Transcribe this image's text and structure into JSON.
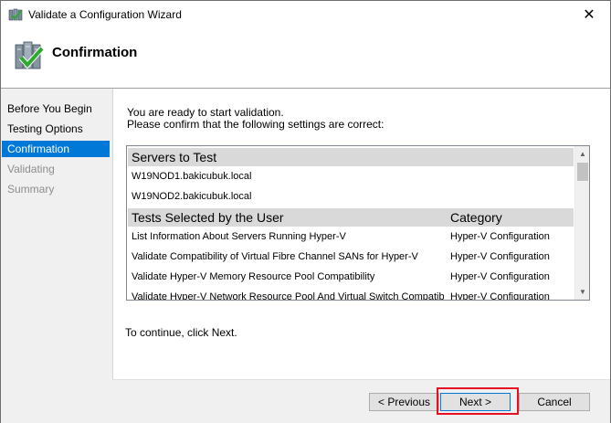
{
  "window": {
    "title": "Validate a Configuration Wizard",
    "close_glyph": "✕"
  },
  "header": {
    "title": "Confirmation",
    "icon": "validation-checklist-icon"
  },
  "sidebar": {
    "items": [
      {
        "label": "Before You Begin",
        "state": "normal"
      },
      {
        "label": "Testing Options",
        "state": "normal"
      },
      {
        "label": "Confirmation",
        "state": "active"
      },
      {
        "label": "Validating",
        "state": "disabled"
      },
      {
        "label": "Summary",
        "state": "disabled"
      }
    ]
  },
  "content": {
    "intro_line1": "You are ready to start validation.",
    "intro_line2": "Please confirm that the following settings are correct:",
    "servers_header": "Servers to Test",
    "servers": [
      "W19NOD1.bakicubuk.local",
      "W19NOD2.bakicubuk.local"
    ],
    "tests_header": "Tests Selected by the User",
    "category_header": "Category",
    "tests": [
      {
        "name": "List Information About Servers Running Hyper-V",
        "category": "Hyper-V Configuration"
      },
      {
        "name": "Validate Compatibility of Virtual Fibre Channel SANs for Hyper-V",
        "category": "Hyper-V Configuration"
      },
      {
        "name": "Validate Hyper-V Memory Resource Pool Compatibility",
        "category": "Hyper-V Configuration"
      },
      {
        "name": "Validate Hyper-V Network Resource Pool And Virtual Switch Compatibi",
        "category": "Hyper-V Configuration"
      }
    ],
    "continue_text": "To continue, click Next."
  },
  "buttons": {
    "previous": "< Previous",
    "next": "Next >",
    "cancel": "Cancel"
  },
  "colors": {
    "accent": "#0078d7",
    "highlight": "#e81123"
  }
}
